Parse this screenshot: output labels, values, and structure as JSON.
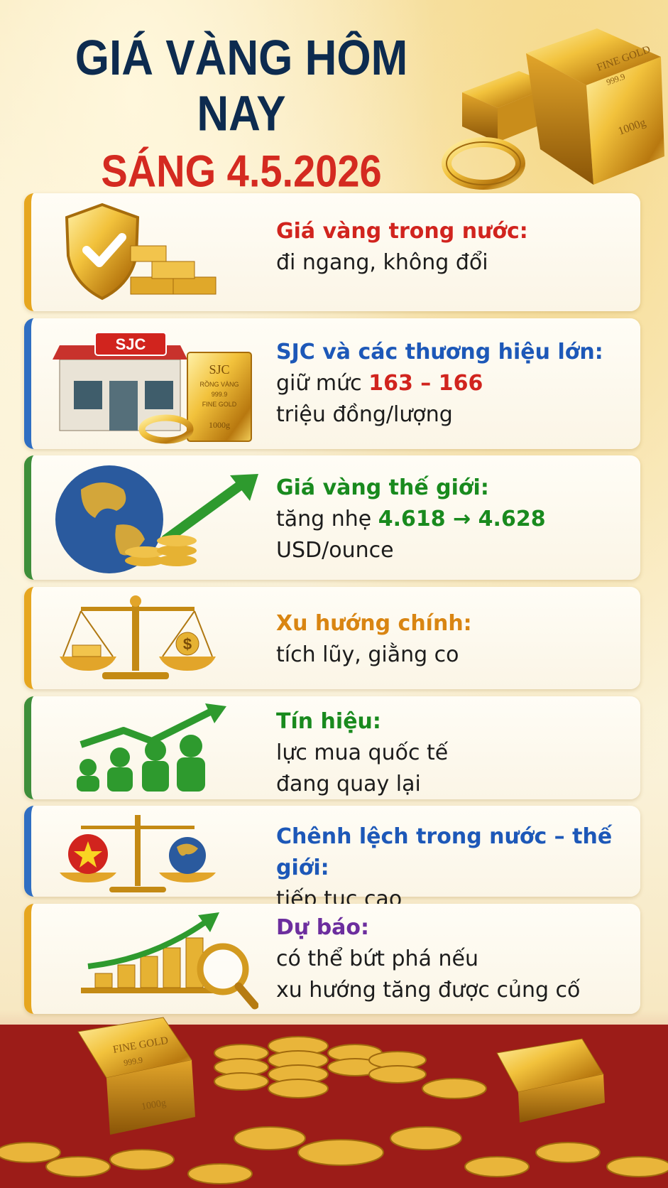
{
  "header": {
    "title_line1": "GIÁ VÀNG HÔM NAY",
    "title_line2": "SÁNG 4.5.2026",
    "hero_bar_text": "FINE GOLD",
    "hero_bar_purity": "999.9",
    "hero_bar_weight": "1000g"
  },
  "cards": [
    {
      "heading": "Giá vàng trong nước:",
      "line1": "đi ngang, không đổi",
      "icon": "shield-check-icon"
    },
    {
      "heading": "SJC và các thương hiệu lớn:",
      "line1_prefix": "giữ mức ",
      "line1_value": "163 – 166",
      "line2": "triệu đồng/lượng",
      "shop_sign": "SJC",
      "bar_brand": "SJC",
      "bar_line1": "RỒNG VÀNG",
      "bar_line2": "999.9",
      "bar_line3": "FINE GOLD",
      "bar_line4": "1000g",
      "icon": "sjc-store-icon"
    },
    {
      "heading": "Giá vàng thế giới:",
      "line1_prefix": "tăng nhẹ ",
      "line1_value": "4.618 → 4.628",
      "line2": "USD/ounce",
      "icon": "globe-coins-icon"
    },
    {
      "heading": "Xu hướng chính:",
      "line1": "tích lũy, giằng co",
      "icon": "balance-scale-icon"
    },
    {
      "heading": "Tín hiệu:",
      "line1": "lực mua quốc tế",
      "line2": "đang quay lại",
      "icon": "growing-people-icon"
    },
    {
      "heading": "Chênh lệch trong nước – thế giới:",
      "line1": "tiếp tục cao",
      "icon": "vietnam-world-scale-icon"
    },
    {
      "heading": "Dự báo:",
      "line1": "có thể bứt phá nếu",
      "line2": "xu hướng tăng được củng cố",
      "icon": "forecast-chart-icon"
    }
  ],
  "footer": {
    "bar_text": "FINE GOLD",
    "bar_purity": "999.9",
    "bar_weight": "1000g"
  }
}
